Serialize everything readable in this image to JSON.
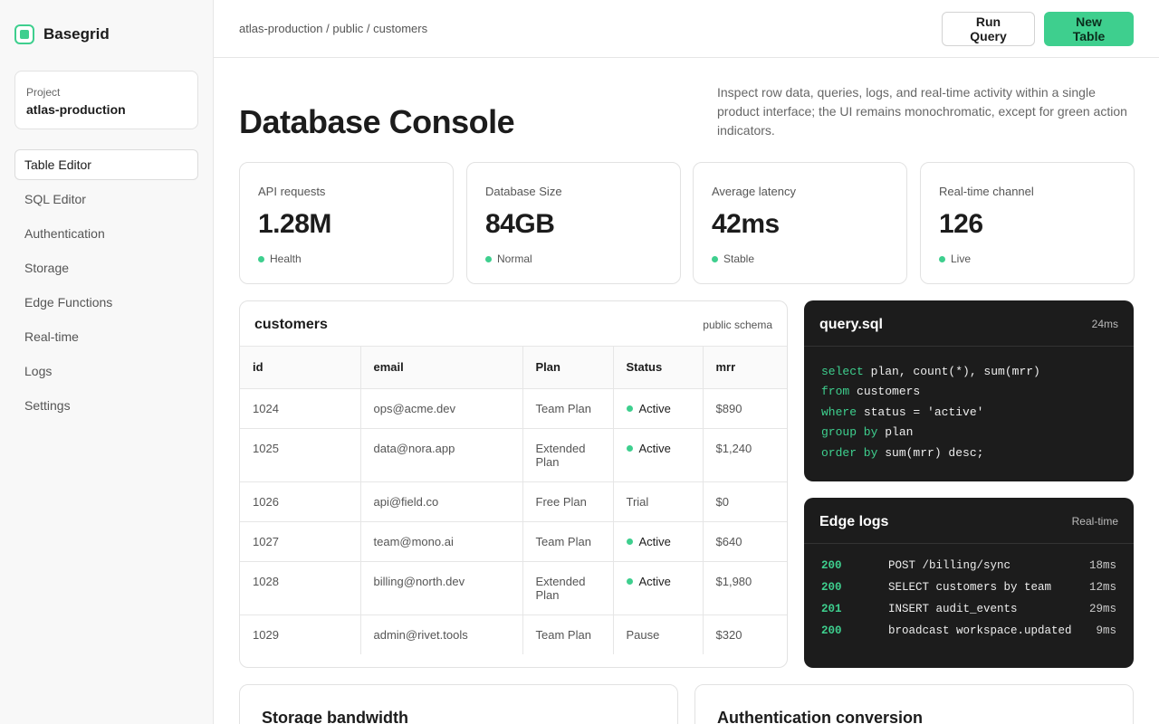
{
  "app": {
    "name": "Basegrid"
  },
  "project": {
    "label": "Project",
    "name": "atlas-production"
  },
  "sidebar": {
    "items": [
      {
        "label": "Table Editor",
        "active": true
      },
      {
        "label": "SQL Editor"
      },
      {
        "label": "Authentication"
      },
      {
        "label": "Storage"
      },
      {
        "label": "Edge Functions"
      },
      {
        "label": "Real-time"
      },
      {
        "label": "Logs"
      },
      {
        "label": "Settings"
      }
    ]
  },
  "header": {
    "breadcrumb": "atlas-production / public / customers",
    "run_query_label": "Run Query",
    "new_table_label": "New Table"
  },
  "page": {
    "title": "Database Console",
    "description": "Inspect row data, queries, logs, and real-time activity within a single product interface; the UI remains monochromatic, except for green action indicators."
  },
  "stats": [
    {
      "label": "API requests",
      "value": "1.28M",
      "status": "Health"
    },
    {
      "label": "Database Size",
      "value": "84GB",
      "status": "Normal"
    },
    {
      "label": "Average latency",
      "value": "42ms",
      "status": "Stable"
    },
    {
      "label": "Real-time channel",
      "value": "126",
      "status": "Live"
    }
  ],
  "table": {
    "title": "customers",
    "subtitle": "public schema",
    "columns": [
      "id",
      "email",
      "Plan",
      "Status",
      "mrr"
    ],
    "rows": [
      {
        "id": "1024",
        "email": "ops@acme.dev",
        "plan": "Team Plan",
        "status": "Active",
        "mrr": "$890"
      },
      {
        "id": "1025",
        "email": "data@nora.app",
        "plan": "Extended Plan",
        "status": "Active",
        "mrr": "$1,240"
      },
      {
        "id": "1026",
        "email": "api@field.co",
        "plan": "Free Plan",
        "status": "Trial",
        "mrr": "$0"
      },
      {
        "id": "1027",
        "email": "team@mono.ai",
        "plan": "Team Plan",
        "status": "Active",
        "mrr": "$640"
      },
      {
        "id": "1028",
        "email": "billing@north.dev",
        "plan": "Extended Plan",
        "status": "Active",
        "mrr": "$1,980"
      },
      {
        "id": "1029",
        "email": "admin@rivet.tools",
        "plan": "Team Plan",
        "status": "Pause",
        "mrr": "$320"
      }
    ]
  },
  "query": {
    "title": "query.sql",
    "duration": "24ms",
    "lines": [
      [
        {
          "kw": "select"
        },
        {
          "t": " plan, count(*), sum(mrr)"
        }
      ],
      [
        {
          "kw": "from"
        },
        {
          "t": " customers"
        }
      ],
      [
        {
          "kw": "where"
        },
        {
          "t": " status = 'active'"
        }
      ],
      [
        {
          "kw": "group by"
        },
        {
          "t": " plan"
        }
      ],
      [
        {
          "kw": "order by"
        },
        {
          "t": " sum(mrr) desc;"
        }
      ]
    ]
  },
  "logs": {
    "title": "Edge logs",
    "meta": "Real-time",
    "entries": [
      {
        "code": "200",
        "message": "POST /billing/sync",
        "time": "18ms"
      },
      {
        "code": "200",
        "message": "SELECT customers by team",
        "time": "12ms"
      },
      {
        "code": "201",
        "message": "INSERT audit_events",
        "time": "29ms"
      },
      {
        "code": "200",
        "message": "broadcast workspace.updated",
        "time": "9ms"
      }
    ]
  },
  "bottom": {
    "storage_title": "Storage bandwidth",
    "auth_title": "Authentication conversion"
  },
  "colors": {
    "accent": "#3ecf8e",
    "dark_card": "#1c1c1c"
  }
}
